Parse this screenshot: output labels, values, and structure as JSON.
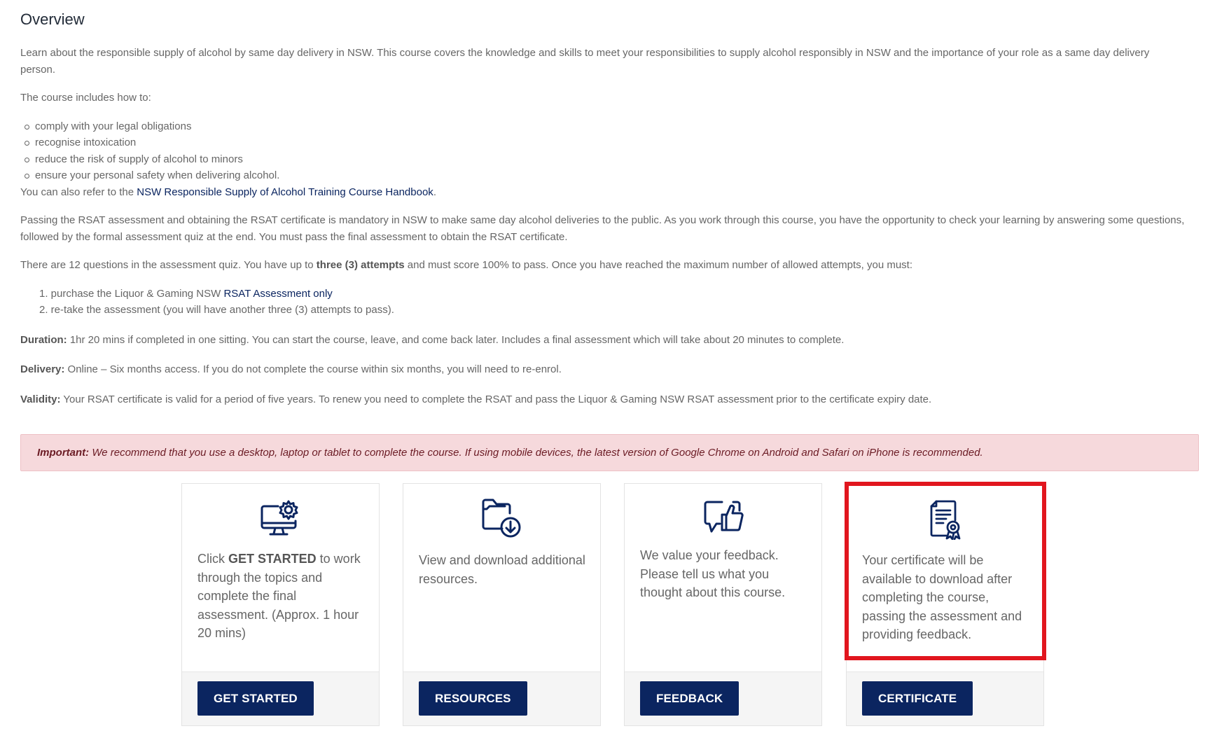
{
  "overview": {
    "title": "Overview",
    "intro": "Learn about the responsible supply of alcohol by same day delivery in NSW. This course covers the knowledge and skills to meet your responsibilities to supply alcohol responsibly in NSW and the importance of your role as a same day delivery person.",
    "includes_heading": "The course includes how to:",
    "includes": [
      "comply with your legal obligations",
      "recognise intoxication",
      "reduce the risk of supply of alcohol to minors",
      "ensure your personal safety when delivering alcohol."
    ],
    "handbook_prefix": "You can also refer to the ",
    "handbook_link": "NSW Responsible Supply of Alcohol Training Course Handbook",
    "handbook_suffix": ".",
    "passing": "Passing the RSAT assessment and obtaining the RSAT certificate is mandatory in NSW to make same day alcohol deliveries to the public. As you work through this course, you have the opportunity to check your learning by answering some questions, followed by the formal assessment quiz at the end. You must pass the final assessment to obtain the RSAT certificate.",
    "quiz_prefix": "There are 12 questions in the assessment quiz. You have up to ",
    "quiz_bold": "three (3) attempts",
    "quiz_suffix": " and must score 100% to pass. Once you have reached the maximum number of allowed attempts, you must:",
    "step1_prefix": "1. purchase the Liquor & Gaming NSW ",
    "step1_link": "RSAT Assessment only",
    "step2": "2. re-take the assessment (you will have another three (3) attempts to pass).",
    "duration_label": "Duration:",
    "duration_text": " 1hr 20 mins if completed in one sitting. You can start the course, leave, and come back later. Includes a final assessment which will take about 20 minutes to complete.",
    "delivery_label": "Delivery:",
    "delivery_text": " Online – Six months access. If you do not complete the course within six months, you will need to re-enrol.",
    "validity_label": "Validity:",
    "validity_text": " Your RSAT certificate is valid for a period of five years. To renew you need to complete the RSAT and pass the Liquor & Gaming NSW RSAT assessment prior to the certificate expiry date."
  },
  "alert": {
    "label": "Important:",
    "text": " We recommend that you use a desktop, laptop or tablet to complete the course. If using mobile devices, the latest version of Google Chrome on Android and Safari on iPhone is recommended."
  },
  "cards": [
    {
      "icon": "computer-settings-icon",
      "desc_prefix": "Click ",
      "desc_bold": "GET STARTED",
      "desc_suffix": " to work through the topics and complete the final assessment. (Approx. 1 hour 20 mins)",
      "button": "GET STARTED"
    },
    {
      "icon": "folder-download-icon",
      "desc": "View and download additional resources.",
      "button": "RESOURCES"
    },
    {
      "icon": "feedback-thumbs-up-icon",
      "desc": "We value your feedback. Please tell us what you thought about this course.",
      "button": "FEEDBACK"
    },
    {
      "icon": "certificate-icon",
      "desc": "Your certificate will be available to download after completing the course, passing the assessment and providing feedback.",
      "button": "CERTIFICATE"
    }
  ],
  "colors": {
    "navy": "#0b2560",
    "alert_bg": "#f6d9dc",
    "alert_text": "#6b1b24",
    "highlight": "#e1161e"
  }
}
